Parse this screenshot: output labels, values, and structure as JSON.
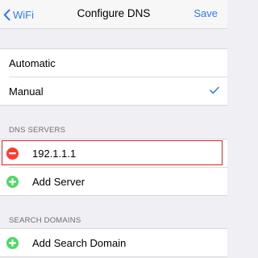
{
  "navbar": {
    "back_label": "WiFi",
    "title": "Configure DNS",
    "action_label": "Save"
  },
  "mode": {
    "options": [
      {
        "label": "Automatic",
        "selected": false
      },
      {
        "label": "Manual",
        "selected": true
      }
    ]
  },
  "dns_servers": {
    "header": "DNS SERVERS",
    "entries": [
      "192.1.1.1"
    ],
    "add_label": "Add Server"
  },
  "search_domains": {
    "header": "SEARCH DOMAINS",
    "add_label": "Add Search Domain"
  },
  "colors": {
    "accent": "#2f7cf6",
    "delete": "#ff3b30",
    "add": "#4cd964",
    "highlight": "#e02020",
    "background": "#efeff4"
  }
}
